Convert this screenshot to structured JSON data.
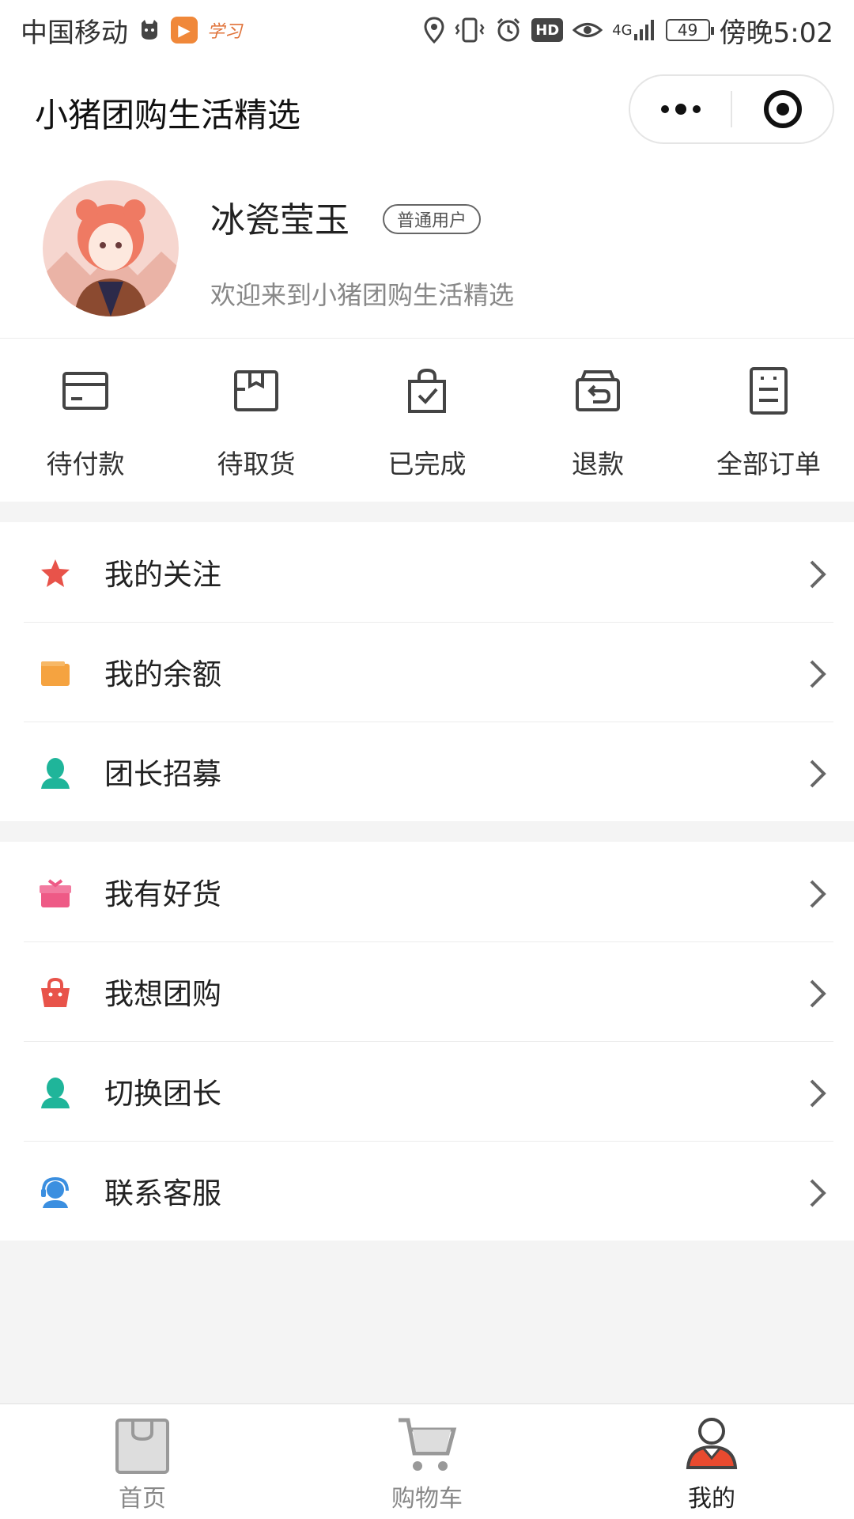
{
  "status_bar": {
    "carrier": "中国移动",
    "study_label": "学习",
    "hd_label": "HD",
    "signal_label": "4G",
    "battery": "49",
    "time": "傍晚5:02"
  },
  "nav": {
    "title": "小猪团购生活精选"
  },
  "profile": {
    "username": "冰瓷莹玉",
    "badge": "普通用户",
    "welcome": "欢迎来到小猪团购生活精选"
  },
  "orders": [
    {
      "label": "待付款",
      "icon": "wallet-card-icon"
    },
    {
      "label": "待取货",
      "icon": "package-box-icon"
    },
    {
      "label": "已完成",
      "icon": "bag-check-icon"
    },
    {
      "label": "退款",
      "icon": "refund-box-icon"
    },
    {
      "label": "全部订单",
      "icon": "order-list-icon"
    }
  ],
  "menu_group_1": [
    {
      "label": "我的关注",
      "icon": "star-icon",
      "color": "#e8534a"
    },
    {
      "label": "我的余额",
      "icon": "wallet-icon",
      "color": "#f5a340"
    },
    {
      "label": "团长招募",
      "icon": "person-icon",
      "color": "#1fb59a"
    }
  ],
  "menu_group_2": [
    {
      "label": "我有好货",
      "icon": "gift-icon",
      "color": "#ee5a86"
    },
    {
      "label": "我想团购",
      "icon": "basket-icon",
      "color": "#e8534a"
    },
    {
      "label": "切换团长",
      "icon": "person-icon",
      "color": "#1fb59a"
    },
    {
      "label": "联系客服",
      "icon": "headset-icon",
      "color": "#3b8fe0"
    }
  ],
  "tabs": [
    {
      "label": "首页",
      "icon": "shopping-bag-icon",
      "active": false
    },
    {
      "label": "购物车",
      "icon": "cart-icon",
      "active": false
    },
    {
      "label": "我的",
      "icon": "user-icon",
      "active": true
    }
  ],
  "colors": {
    "accent": "#e84a2f",
    "background": "#f4f4f4"
  }
}
